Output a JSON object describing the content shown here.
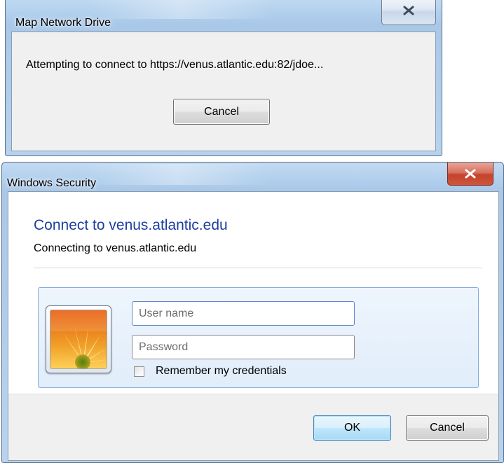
{
  "map_drive_dialog": {
    "title": "Map Network Drive",
    "message": "Attempting to connect to https://venus.atlantic.edu:82/jdoe...",
    "cancel_label": "Cancel",
    "close_glyph": "X"
  },
  "security_dialog": {
    "title": "Windows Security",
    "heading": "Connect to venus.atlantic.edu",
    "subheading": "Connecting to venus.atlantic.edu",
    "close_glyph": "X",
    "username_placeholder": "User name",
    "password_placeholder": "Password",
    "remember_label": "Remember my credentials",
    "ok_label": "OK",
    "cancel_label": "Cancel",
    "avatar_icon": "user-avatar-flower-icon"
  }
}
